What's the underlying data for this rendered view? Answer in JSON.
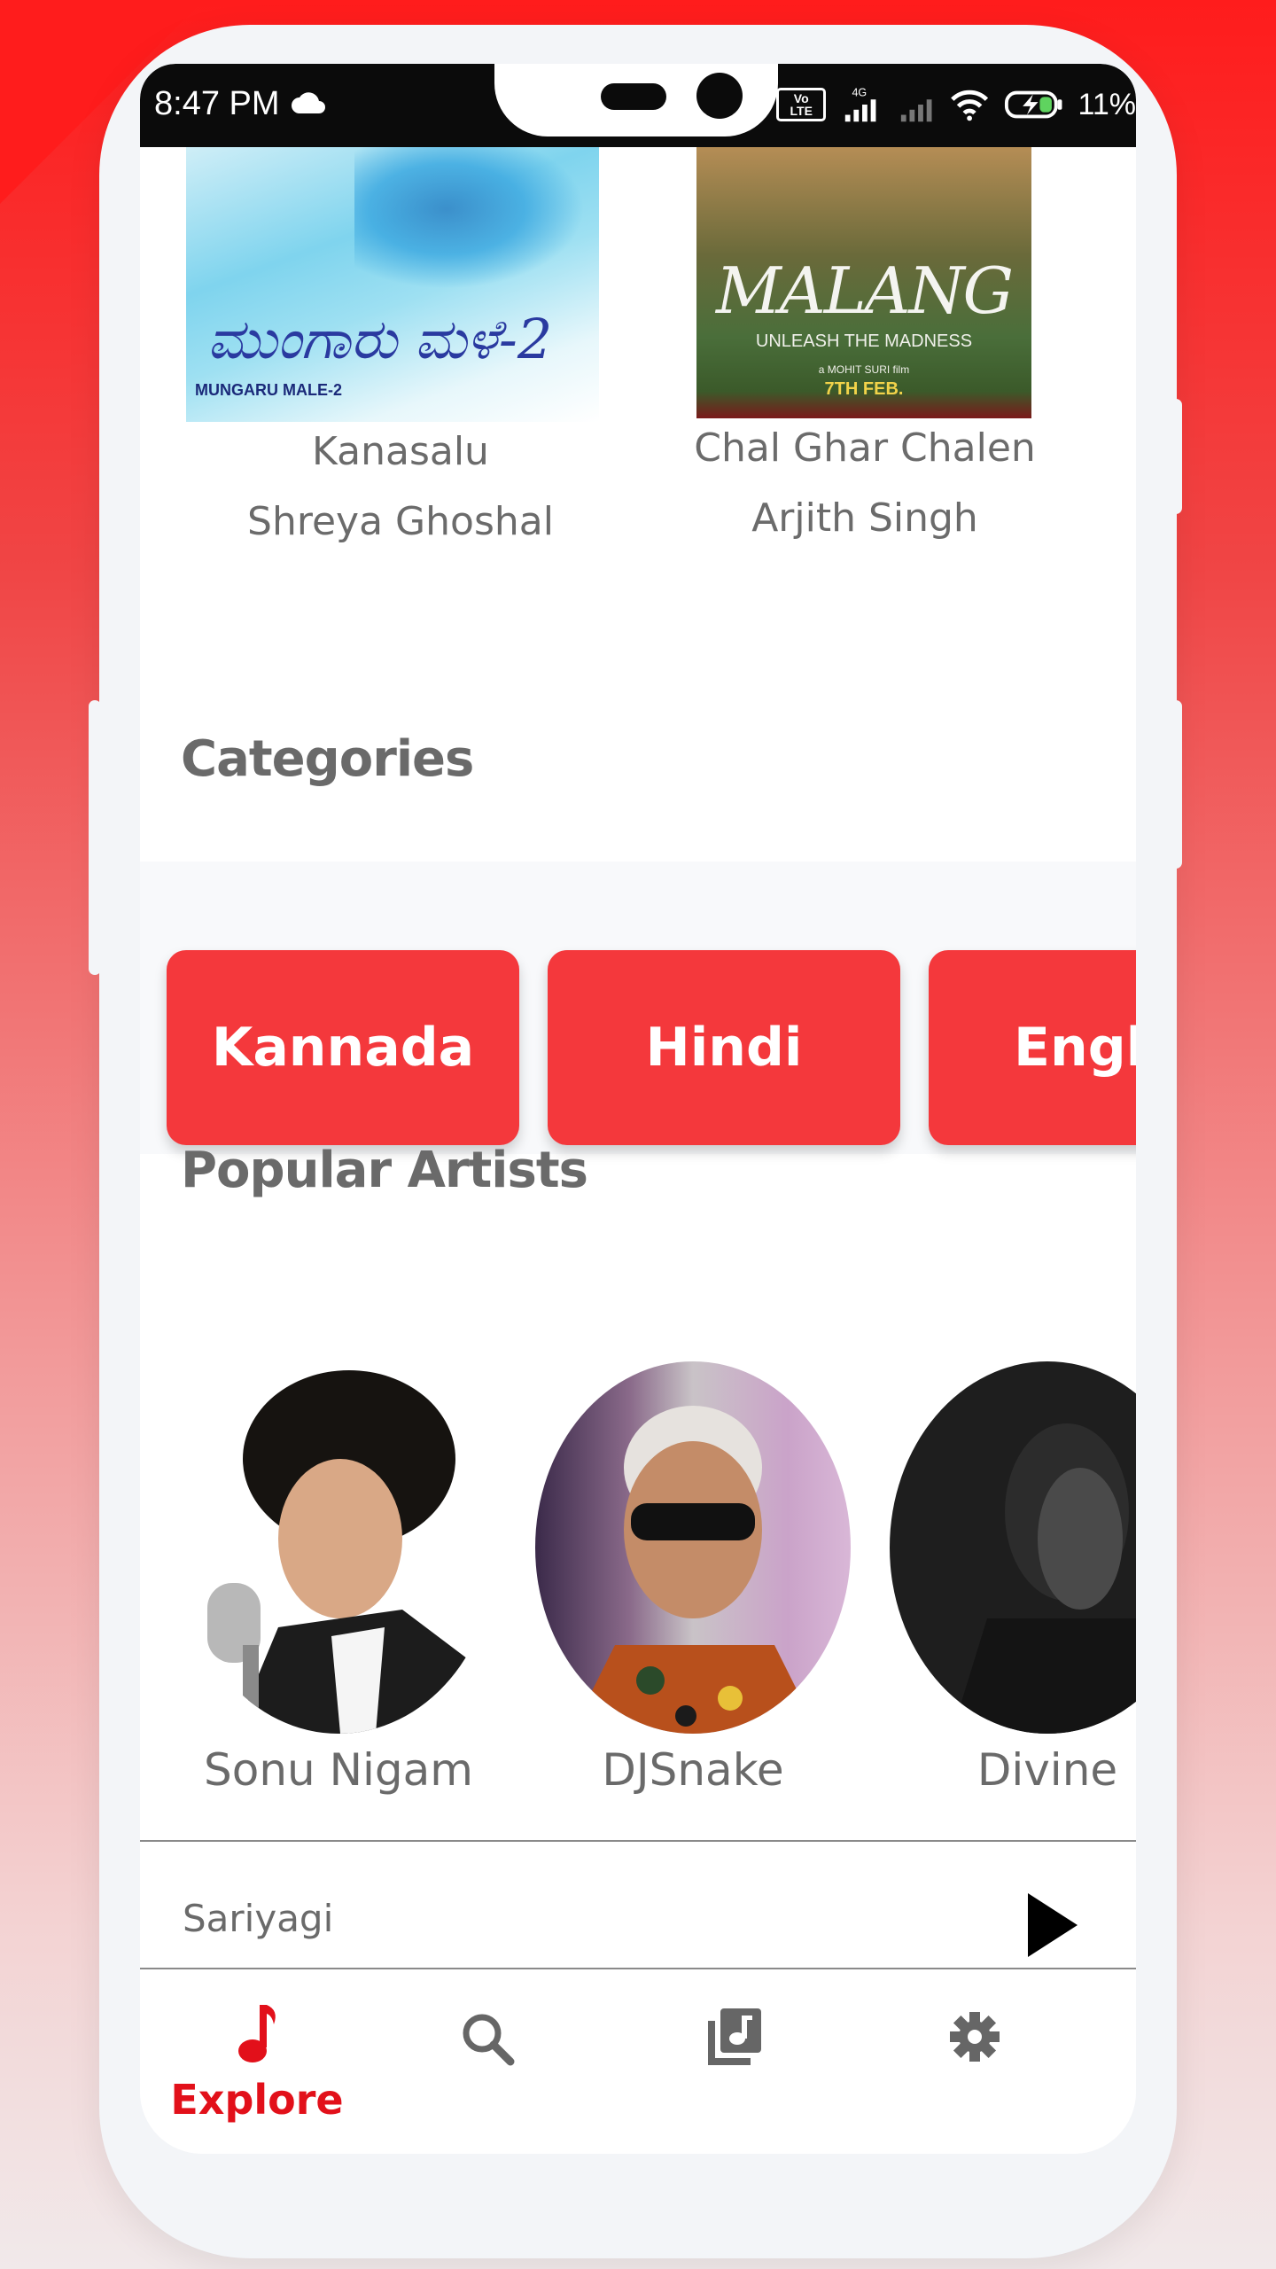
{
  "status_bar": {
    "time": "8:47 PM",
    "network": "4G",
    "volte": "Vo LTE",
    "battery": "11%"
  },
  "songs": [
    {
      "title": "Kanasalu",
      "artist": "Shreya Ghoshal",
      "album_art": {
        "main_text": "ಮುಂಗಾರು ಮಳೆ-2",
        "caption": "MUNGARU MALE-2"
      }
    },
    {
      "title": "Chal Ghar Chalen",
      "artist": "Arjith Singh",
      "album_art": {
        "title": "MALANG",
        "tagline": "UNLEASH THE MADNESS",
        "director": "a MOHIT SURI film",
        "release": "7TH FEB."
      }
    }
  ],
  "categories": {
    "title": "Categories",
    "items": [
      "Kannada",
      "Hindi",
      "Engli"
    ]
  },
  "popular_artists": {
    "title": "Popular Artists",
    "items": [
      "Sonu Nigam",
      "DJSnake",
      "Divine"
    ]
  },
  "now_playing": {
    "title": "Sariyagi"
  },
  "bottom_nav": {
    "items": [
      {
        "label": "Explore",
        "icon": "music-note-icon",
        "active": true
      },
      {
        "label": "",
        "icon": "search-icon",
        "active": false
      },
      {
        "label": "",
        "icon": "library-music-icon",
        "active": false
      },
      {
        "label": "",
        "icon": "settings-icon",
        "active": false
      }
    ]
  },
  "colors": {
    "accent": "#e2101a",
    "category_button": "#f4383c",
    "text_secondary": "#6b6b6b"
  }
}
